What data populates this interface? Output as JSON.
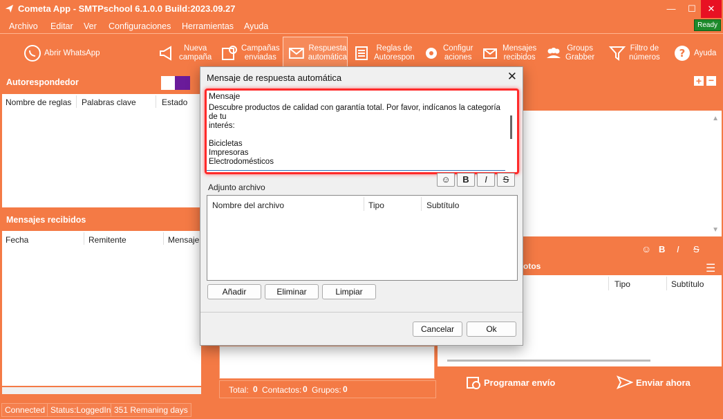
{
  "window": {
    "title": "Cometa App - SMTPschool 6.1.0.0 Build:2023.09.27",
    "minimize": "—",
    "maximize": "☐",
    "close": "✕"
  },
  "menu": [
    "Archivo",
    "Editar",
    "Ver",
    "Configuraciones",
    "Herramientas",
    "Ayuda"
  ],
  "ready_badge": "Ready",
  "toolbar": {
    "whatsapp": "Abrir WhatsApp",
    "nueva_campana": [
      "Nueva",
      "campaña"
    ],
    "campanas_enviadas": [
      "Campañas",
      "enviadas"
    ],
    "respuesta_automatica": [
      "Respuesta",
      "automática"
    ],
    "reglas_autorespon": [
      "Reglas de",
      "Autorespon"
    ],
    "configuraciones": [
      "Configur",
      "aciones"
    ],
    "mensajes_recibidos": [
      "Mensajes",
      "recibidos"
    ],
    "groups_grabber": [
      "Groups",
      "Grabber"
    ],
    "filtro_numeros": [
      "Filtro de",
      "números"
    ],
    "ayuda": "Ayuda"
  },
  "autoresponder": {
    "title": "Autorespondedor",
    "columns": [
      "Nombre de reglas",
      "Palabras clave",
      "Estado"
    ]
  },
  "received": {
    "title": "Mensajes recibidos",
    "columns": [
      "Fecha",
      "Remitente",
      "Mensaje"
    ]
  },
  "right_panel": {
    "attachments_title_partial": "otos",
    "columns": [
      "Tipo",
      "Subtítulo"
    ]
  },
  "totals": {
    "total_label": "Total:",
    "total": "0",
    "contactos_label": "Contactos:",
    "contactos": "0",
    "grupos_label": "Grupos:",
    "grupos": "0"
  },
  "actions": {
    "schedule": "Programar envío",
    "send_now": "Enviar ahora"
  },
  "status": {
    "connection": "Connected",
    "login": "Status:LoggedIn",
    "days": "351 Remaning days"
  },
  "dialog": {
    "title": "Mensaje de respuesta automática",
    "message_label": "Mensaje",
    "message_text": "Descubre productos de calidad con garantía total. Por favor, indícanos la categoría de tu\ninterés:\n\nBicicletas\nImpresoras\nElectrodomésticos\nDecoración",
    "format_buttons": {
      "emoji": "☺",
      "bold": "B",
      "italic": "I",
      "strike": "S"
    },
    "attachment_label": "Adjunto archivo",
    "attachment_columns": [
      "Nombre del archivo",
      "Tipo",
      "Subtítulo"
    ],
    "add_button": "Añadir",
    "delete_button": "Eliminar",
    "clear_button": "Limpiar",
    "cancel_button": "Cancelar",
    "ok_button": "Ok"
  },
  "colors": {
    "accent": "#f47a45",
    "highlight": "#ff2a2a",
    "purple": "#6a1b9a",
    "ready": "#1d8a2b"
  }
}
